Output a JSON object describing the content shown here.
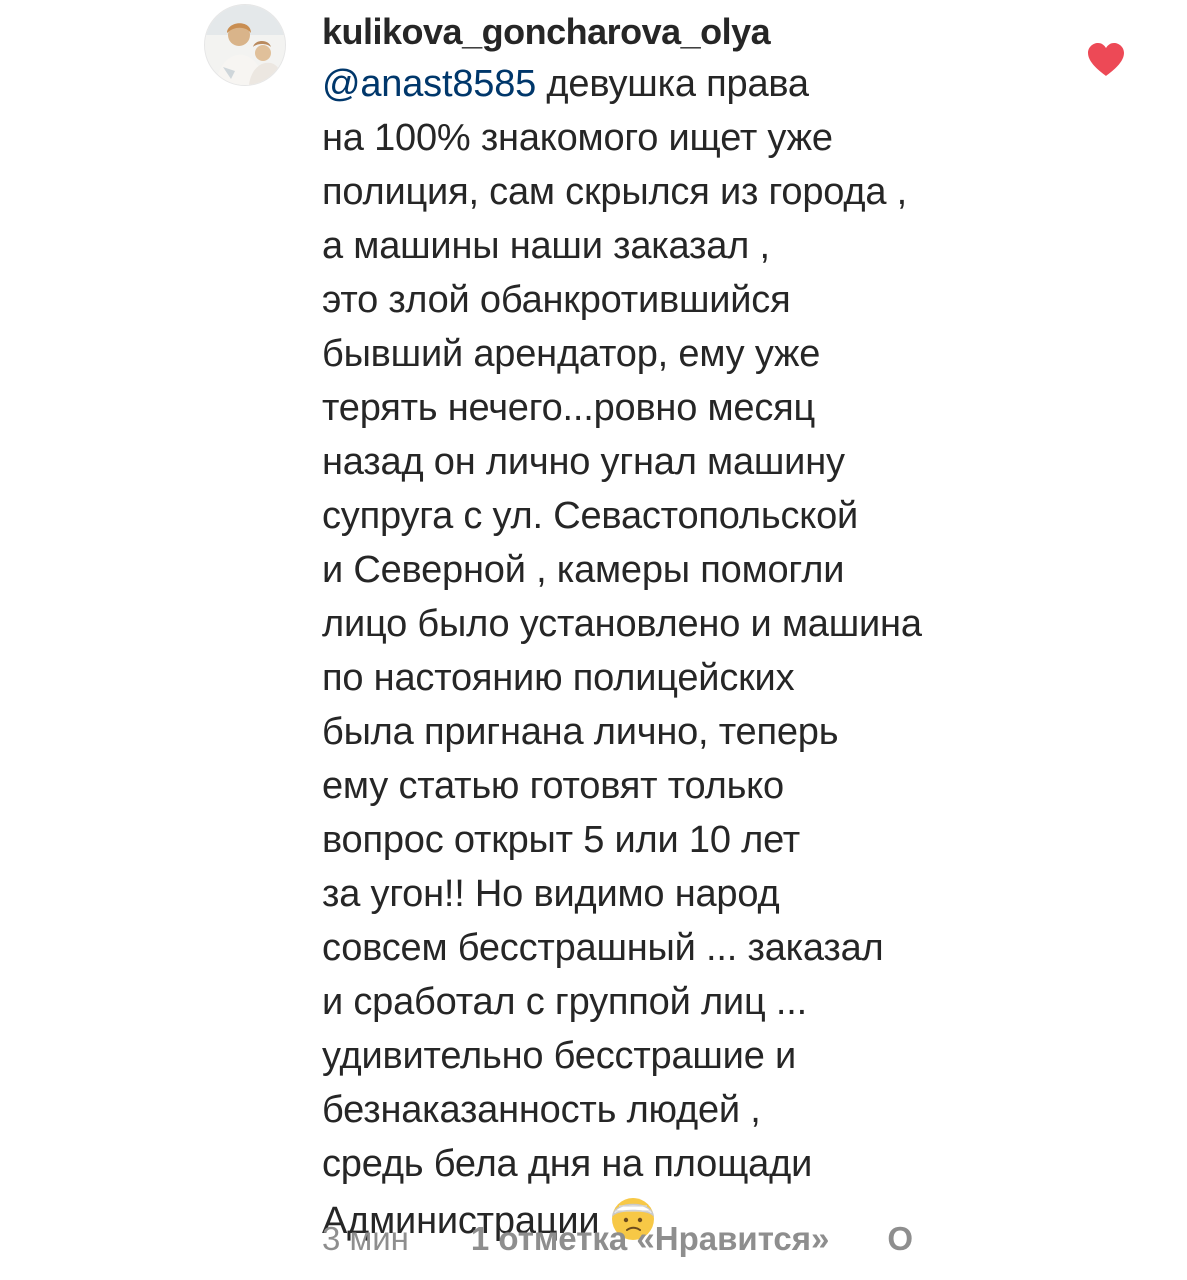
{
  "comment": {
    "username": "kulikova_goncharova_olya",
    "mention": "@anast8585",
    "text": " девушка права\nна 100% знакомого ищет уже\nполиция, сам скрылся из города ,\nа машины наши заказал ,\nэто злой обанкротившийся\nбывший арендатор, ему уже\nтерять нечего...ровно месяц\nназад он лично угнал машину\nсупруга с ул. Севастопольской\nи Северной , камеры помогли\nлицо было установлено и машина\nпо настоянию полицейских\nбыла пригнана лично, теперь\nему статью готовят только\nвопрос открыт 5 или 10 лет\nза угон!! Но видимо народ\nсовсем бесстрашный ... заказал\nи сработал с группой лиц ...\nудивительно бесстрашие и\nбезнаказанность людей ,\nсредь бела дня на площади\nАдминистрации",
    "emoji": "face-with-head-bandage-emoji",
    "time": "3 мин",
    "likes": "1 отметка «Нравится»",
    "reply": "О"
  },
  "colors": {
    "text": "#262626",
    "mention": "#00376b",
    "meta": "#8e8e8e",
    "heart": "#ed4956"
  },
  "icons": {
    "like": "heart-icon",
    "avatar": "avatar"
  }
}
